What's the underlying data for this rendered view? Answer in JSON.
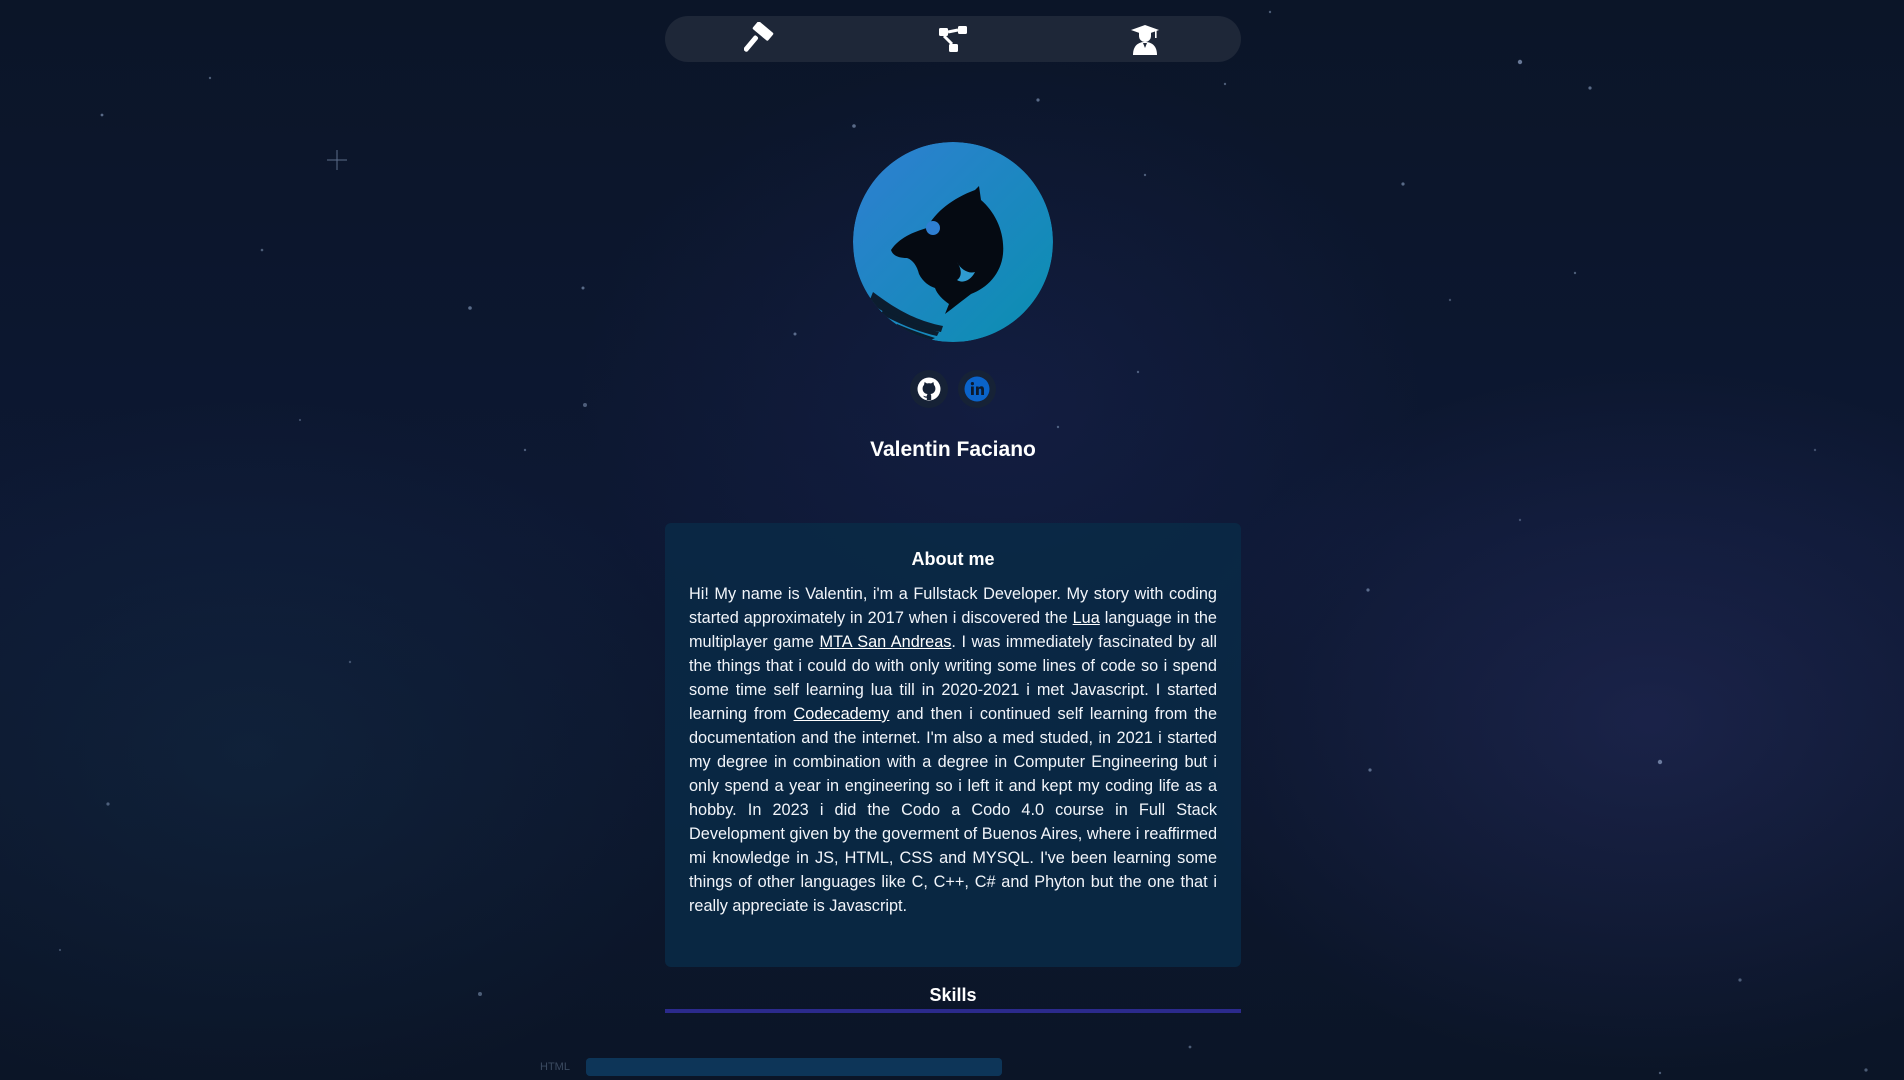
{
  "nav": {
    "items": [
      {
        "icon": "hammer-icon",
        "label": ""
      },
      {
        "icon": "network-icon",
        "label": ""
      },
      {
        "icon": "graduate-icon",
        "label": ""
      }
    ]
  },
  "profile": {
    "avatar_icon": "dolphin-icon",
    "name": "Valentin Faciano",
    "socials": [
      {
        "icon": "github-icon"
      },
      {
        "icon": "linkedin-icon"
      }
    ]
  },
  "about": {
    "title": "About me",
    "p1": "Hi! My name is Valentin, i'm a Fullstack Developer. My story with coding started approximately in 2017 when i discovered the ",
    "link_lua": "Lua",
    "p2": " language in the multiplayer game ",
    "link_mta": "MTA San Andreas",
    "p3": ". I was immediately fascinated by all the things that i could do with only writing some lines of code so i spend some time self learning lua till in 2020-2021 i met Javascript. I started learning from ",
    "link_codecademy": "Codecademy",
    "p4": " and then i continued self learning from the documentation and the internet. I'm also a med studed, in 2021 i started my degree in combination with a degree in Computer Engineering but i only spend a year in engineering so i left it and kept my coding life as a hobby. In 2023 i did the Codo a Codo 4.0 course in Full Stack Development given by the goverment of Buenos Aires, where i reaffirmed mi knowledge in JS, HTML, CSS and MYSQL. I've been learning some things of other languages like C, C++, C# and Phyton but the one that i really appreciate is Javascript."
  },
  "skills": {
    "title": "Skills",
    "items": [
      {
        "label": "HTML"
      }
    ]
  },
  "colors": {
    "background": "#0b1528",
    "nav_bg": "#1e2738",
    "card_bg": "#092a46",
    "accent_line": "#2b2a8c",
    "avatar_gradient_start": "#2f7fd2",
    "avatar_gradient_end": "#0a8fb0"
  }
}
